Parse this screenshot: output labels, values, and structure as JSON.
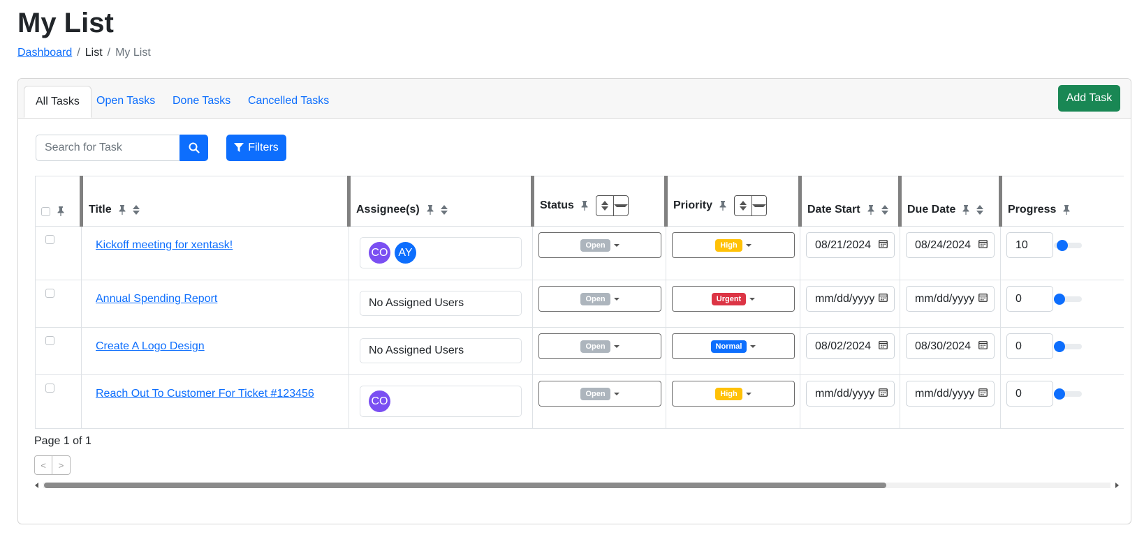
{
  "page": {
    "title": "My List"
  },
  "breadcrumb": {
    "home": "Dashboard",
    "sep": "/",
    "list": "List",
    "current": "My List"
  },
  "tabs": [
    {
      "label": "All Tasks",
      "active": true
    },
    {
      "label": "Open Tasks",
      "active": false
    },
    {
      "label": "Done Tasks",
      "active": false
    },
    {
      "label": "Cancelled Tasks",
      "active": false
    }
  ],
  "toolbar": {
    "add_label": "Add Task",
    "search_placeholder": "Search for Task",
    "filters_label": "Filters"
  },
  "table": {
    "headers": {
      "title": "Title",
      "assignees": "Assignee(s)",
      "status": "Status",
      "priority": "Priority",
      "date_start": "Date Start",
      "due_date": "Due Date",
      "progress": "Progress"
    },
    "rows": [
      {
        "title": "Kickoff meeting for xentask!",
        "assignees": [
          "CO",
          "AY"
        ],
        "assignee_colors": [
          "#7a4ff2",
          "#0d6efd"
        ],
        "status": "Open",
        "priority": "High",
        "priority_color": "#ffc107",
        "date_start": "08/21/2024",
        "due_date": "08/24/2024",
        "progress": "10"
      },
      {
        "title": "Annual Spending Report",
        "assignees_text": "No Assigned Users",
        "status": "Open",
        "priority": "Urgent",
        "priority_color": "#dc3545",
        "date_start": "mm/dd/yyyy",
        "due_date": "mm/dd/yyyy",
        "progress": "0"
      },
      {
        "title": "Create A Logo Design",
        "assignees_text": "No Assigned Users",
        "status": "Open",
        "priority": "Normal",
        "priority_color": "#0d6efd",
        "date_start": "08/02/2024",
        "due_date": "08/30/2024",
        "progress": "0"
      },
      {
        "title": "Reach Out To Customer For Ticket #123456",
        "assignees": [
          "CO"
        ],
        "assignee_colors": [
          "#7a4ff2"
        ],
        "status": "Open",
        "priority": "High",
        "priority_color": "#ffc107",
        "date_start": "mm/dd/yyyy",
        "due_date": "mm/dd/yyyy",
        "progress": "0"
      }
    ]
  },
  "pagination": {
    "info": "Page 1 of 1",
    "prev": "<",
    "next": ">"
  },
  "colors": {
    "primary": "#0d6efd",
    "success": "#198754",
    "status_open": "#adb5bd",
    "avatar_purple": "#7a4ff2"
  }
}
